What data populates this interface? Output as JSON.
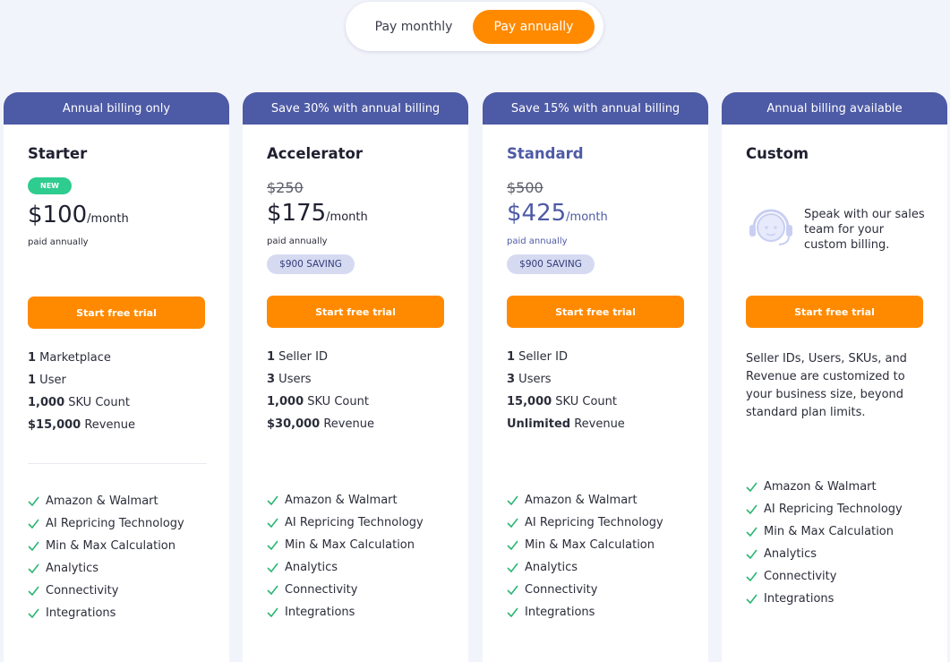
{
  "billing_toggle": {
    "monthly_label": "Pay monthly",
    "annual_label": "Pay annually",
    "selected": "annual"
  },
  "colors": {
    "accent_orange": "#ff8a00",
    "header_blue": "#4d5aa5",
    "new_badge_green": "#2ecc8f",
    "check_green": "#2bb673"
  },
  "plans": [
    {
      "banner": "Annual billing only",
      "name": "Starter",
      "badge": "NEW",
      "price": "$100",
      "per": "/month",
      "paid_note": "paid annually",
      "cta": "Start free trial",
      "specs": [
        {
          "value": "1",
          "label": " Marketplace"
        },
        {
          "value": "1",
          "label": " User"
        },
        {
          "value": "1,000",
          "label": " SKU Count"
        },
        {
          "value": "$15,000",
          "label": " Revenue"
        }
      ],
      "features": [
        "Amazon & Walmart",
        "AI Repricing Technology",
        "Min & Max Calculation",
        "Analytics",
        "Connectivity",
        "Integrations"
      ]
    },
    {
      "banner": "Save 30% with annual billing",
      "name": "Accelerator",
      "old_price": "$250",
      "price": "$175",
      "per": "/month",
      "paid_note": "paid annually",
      "saving": "$900 SAVING",
      "cta": "Start free trial",
      "specs": [
        {
          "value": "1",
          "label": " Seller ID"
        },
        {
          "value": "3",
          "label": " Users"
        },
        {
          "value": "1,000",
          "label": " SKU Count"
        },
        {
          "value": "$30,000",
          "label": " Revenue"
        }
      ],
      "features": [
        "Amazon & Walmart",
        "AI Repricing Technology",
        "Min & Max Calculation",
        "Analytics",
        "Connectivity",
        "Integrations"
      ]
    },
    {
      "banner": "Save 15% with annual billing",
      "name": "Standard",
      "old_price": "$500",
      "price": "$425",
      "per": "/month",
      "paid_note": "paid annually",
      "saving": "$900 SAVING",
      "cta": "Start free trial",
      "specs": [
        {
          "value": "1",
          "label": " Seller ID"
        },
        {
          "value": "3",
          "label": " Users"
        },
        {
          "value": "15,000",
          "label": " SKU Count"
        },
        {
          "value": "Unlimited",
          "label": " Revenue"
        }
      ],
      "features": [
        "Amazon & Walmart",
        "AI Repricing Technology",
        "Min & Max Calculation",
        "Analytics",
        "Connectivity",
        "Integrations"
      ]
    },
    {
      "banner": "Annual billing available",
      "name": "Custom",
      "contact_text": "Speak with our sales team for your custom billing.",
      "contact_icon": "headset-agent-icon",
      "cta": "Start free trial",
      "description": "Seller IDs, Users, SKUs, and Revenue are customized to your business size, beyond standard plan limits.",
      "features": [
        "Amazon & Walmart",
        "AI Repricing Technology",
        "Min & Max Calculation",
        "Analytics",
        "Connectivity",
        "Integrations"
      ]
    }
  ]
}
